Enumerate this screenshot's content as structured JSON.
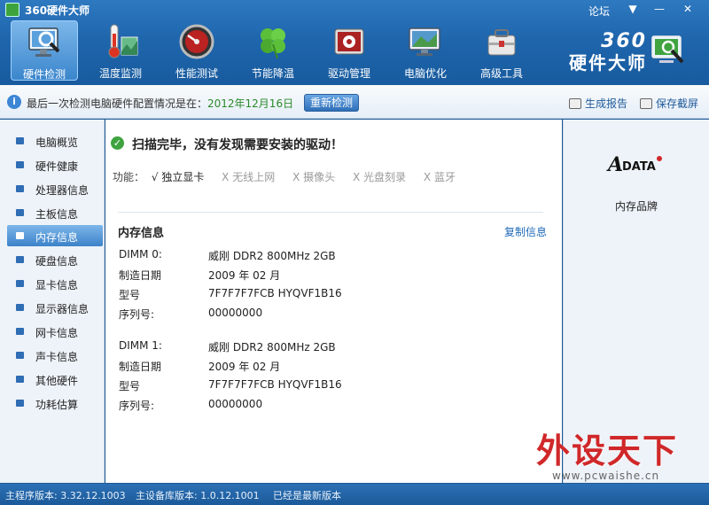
{
  "window": {
    "title": "360硬件大师",
    "forum": "论坛",
    "menu_icon": "chevron-down",
    "min_icon": "minimize",
    "close_icon": "close"
  },
  "toolbar": {
    "items": [
      {
        "label": "硬件检测",
        "icon": "monitor-magnifier-icon"
      },
      {
        "label": "温度监测",
        "icon": "thermometer-icon"
      },
      {
        "label": "性能测试",
        "icon": "speedometer-icon"
      },
      {
        "label": "节能降温",
        "icon": "clover-icon"
      },
      {
        "label": "驱动管理",
        "icon": "driver-box-icon"
      },
      {
        "label": "电脑优化",
        "icon": "monitor-optimize-icon"
      },
      {
        "label": "高级工具",
        "icon": "toolbox-icon"
      }
    ],
    "active_index": 0
  },
  "brand": {
    "line1": "360",
    "line2": "硬件大师"
  },
  "infobar": {
    "message": "最后一次检测电脑硬件配置情况是在：",
    "date": "2012年12月16日",
    "recheck_label": "重新检测",
    "report_label": "生成报告",
    "screenshot_label": "保存截屏"
  },
  "sidebar": {
    "items": [
      {
        "label": "电脑概览"
      },
      {
        "label": "硬件健康"
      },
      {
        "label": "处理器信息"
      },
      {
        "label": "主板信息"
      },
      {
        "label": "内存信息"
      },
      {
        "label": "硬盘信息"
      },
      {
        "label": "显卡信息"
      },
      {
        "label": "显示器信息"
      },
      {
        "label": "网卡信息"
      },
      {
        "label": "声卡信息"
      },
      {
        "label": "其他硬件"
      },
      {
        "label": "功耗估算"
      }
    ],
    "active_index": 4
  },
  "main": {
    "scan_title": "扫描完毕，没有发现需要安装的驱动！",
    "features_label": "功能：",
    "features": [
      {
        "mark": "√",
        "label": "独立显卡",
        "available": true
      },
      {
        "mark": "X",
        "label": "无线上网",
        "available": false
      },
      {
        "mark": "X",
        "label": "摄像头",
        "available": false
      },
      {
        "mark": "X",
        "label": "光盘刻录",
        "available": false
      },
      {
        "mark": "X",
        "label": "蓝牙",
        "available": false
      }
    ],
    "section_title": "内存信息",
    "copy_label": "复制信息",
    "dimm0": [
      {
        "key": "DIMM 0:",
        "value": "威刚 DDR2 800MHz 2GB"
      },
      {
        "key": "制造日期",
        "value": "2009 年 02 月"
      },
      {
        "key": "型号",
        "value": "7F7F7F7FCB HYQVF1B16"
      },
      {
        "key": "序列号:",
        "value": "00000000"
      }
    ],
    "dimm1": [
      {
        "key": "DIMM 1:",
        "value": "威刚 DDR2 800MHz 2GB"
      },
      {
        "key": "制造日期",
        "value": "2009 年 02 月"
      },
      {
        "key": "型号",
        "value": "7F7F7F7FCB HYQVF1B16"
      },
      {
        "key": "序列号:",
        "value": "00000000"
      }
    ]
  },
  "rightpanel": {
    "logo_text": "DATA",
    "logo_letter": "A",
    "caption": "内存品牌"
  },
  "watermark": {
    "text": "外设天下",
    "url": "www.pcwaishe.cn"
  },
  "statusbar": {
    "main_version": "主程序版本: 3.32.12.1003",
    "db_version": "主设备库版本: 1.0.12.1001",
    "status": "已经是最新版本"
  },
  "colors": {
    "accent": "#1f66ad",
    "date_green": "#2a8a2a",
    "link_blue": "#1f6ab8",
    "watermark_red": "#d0282a"
  }
}
